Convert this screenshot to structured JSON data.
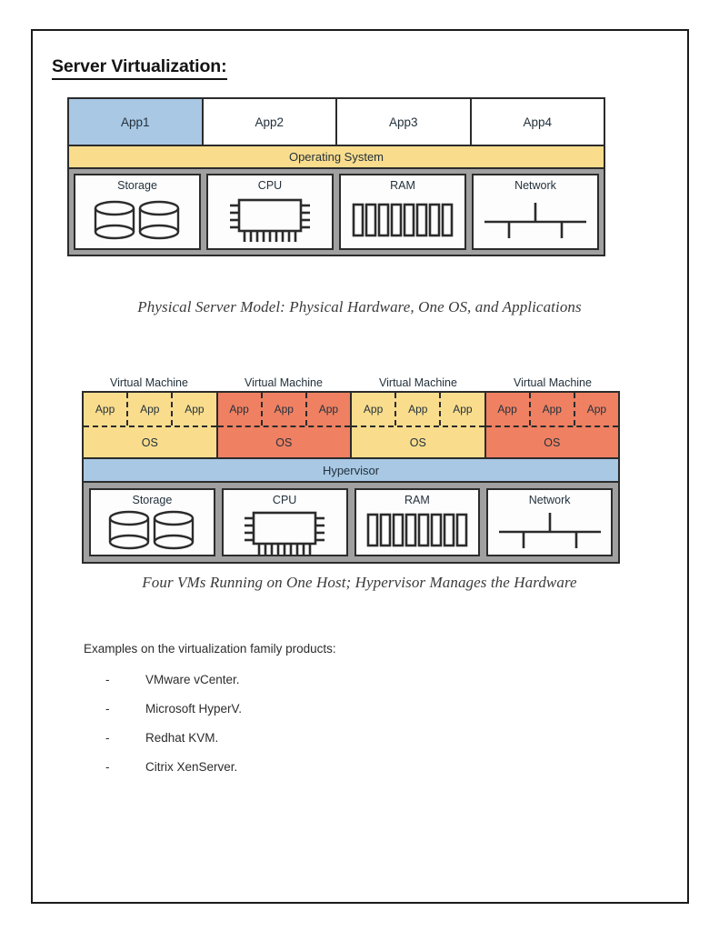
{
  "document": {
    "title": "Server Virtualization:"
  },
  "physical_diagram": {
    "apps": [
      {
        "label": "App1",
        "highlighted": true
      },
      {
        "label": "App2",
        "highlighted": false
      },
      {
        "label": "App3",
        "highlighted": false
      },
      {
        "label": "App4",
        "highlighted": false
      }
    ],
    "os_label": "Operating System",
    "hardware": [
      {
        "label": "Storage",
        "icon": "storage-cylinders-icon"
      },
      {
        "label": "CPU",
        "icon": "cpu-chip-icon"
      },
      {
        "label": "RAM",
        "icon": "ram-modules-icon"
      },
      {
        "label": "Network",
        "icon": "network-bus-icon"
      }
    ],
    "caption": "Physical Server Model: Physical Hardware, One OS, and Applications"
  },
  "virtual_diagram": {
    "vm_label": "Virtual Machine",
    "vm_labels": [
      "Virtual Machine",
      "Virtual Machine",
      "Virtual Machine",
      "Virtual Machine"
    ],
    "vms": [
      {
        "color": "yellow",
        "apps": [
          "App",
          "App",
          "App"
        ],
        "os_label": "OS"
      },
      {
        "color": "red",
        "apps": [
          "App",
          "App",
          "App"
        ],
        "os_label": "OS"
      },
      {
        "color": "yellow",
        "apps": [
          "App",
          "App",
          "App"
        ],
        "os_label": "OS"
      },
      {
        "color": "red",
        "apps": [
          "App",
          "App",
          "App"
        ],
        "os_label": "OS"
      }
    ],
    "hypervisor_label": "Hypervisor",
    "hardware": [
      {
        "label": "Storage",
        "icon": "storage-cylinders-icon"
      },
      {
        "label": "CPU",
        "icon": "cpu-chip-icon"
      },
      {
        "label": "RAM",
        "icon": "ram-modules-icon"
      },
      {
        "label": "Network",
        "icon": "network-bus-icon"
      }
    ],
    "caption": "Four VMs Running on One Host; Hypervisor Manages the Hardware"
  },
  "examples": {
    "heading": "Examples on the virtualization family products:",
    "marker": "-",
    "items": [
      "VMware vCenter.",
      "Microsoft HyperV.",
      "Redhat KVM.",
      "Citrix XenServer."
    ]
  },
  "colors": {
    "app_highlight_blue": "#a8c8e4",
    "os_yellow": "#f9dd8d",
    "vm_red": "#ef8062",
    "hypervisor_blue": "#a8c8e4",
    "hardware_frame_gray": "#a0a0a0",
    "border_black": "#2b2b2b",
    "page_border": "#1b1b1b"
  }
}
